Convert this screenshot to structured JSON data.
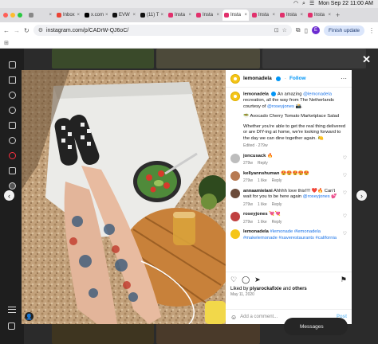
{
  "menubar": {
    "clock": "Mon Sep 22  11:00 AM"
  },
  "tabs": [
    {
      "label": "",
      "color": "#888888",
      "active": false
    },
    {
      "label": "Inbox",
      "color": "#ea4335",
      "active": false
    },
    {
      "label": "x.com",
      "color": "#000000",
      "active": false
    },
    {
      "label": "EVW",
      "color": "#111111",
      "active": false
    },
    {
      "label": "(11) T",
      "color": "#111111",
      "active": false
    },
    {
      "label": "Insta",
      "color": "#e1306c",
      "active": false
    },
    {
      "label": "Insta",
      "color": "#e1306c",
      "active": false
    },
    {
      "label": "Insta",
      "color": "#e1306c",
      "active": true
    },
    {
      "label": "Insta",
      "color": "#e1306c",
      "active": false
    },
    {
      "label": "Insta",
      "color": "#e1306c",
      "active": false
    },
    {
      "label": "Insta",
      "color": "#e1306c",
      "active": false
    }
  ],
  "toolbar": {
    "url": "instagram.com/p/CADrW-QJ6oC/",
    "profile_initial": "E",
    "finish_update": "Finish update"
  },
  "post": {
    "username": "lemonadela",
    "follow": "Follow",
    "caption_user": "lemonadela",
    "caption_text": "An amazing ",
    "caption_mention": "@lemonadela",
    "caption_text2": " recreation, all the way from The Netherlands courtesy of ",
    "caption_mention2": "@roseyjones",
    "caption_emoji": "📸.",
    "caption_line2": "🥗 Avocado Cherry Tomato Marketplace Salad",
    "caption_line3": "Whether you're able to get the real thing delivered or are DIY-ing at home, we're looking forward to the day we can dine together again.",
    "caption_line3_emoji": "🍋",
    "caption_meta": "Edited · 279w",
    "comments": [
      {
        "user": "joncusack",
        "text": "🔥",
        "time": "279w",
        "likes": "",
        "reply": "Reply",
        "avatar": "#bdbdbd"
      },
      {
        "user": "kellyannshuman",
        "text": "😍😍😍😍😍",
        "time": "279w",
        "likes": "1 like",
        "reply": "Reply",
        "avatar": "#b77a52"
      },
      {
        "user": "annaamielani",
        "text": "Ahhhh love this!!!! ❤️🔥 Can't wait for you to be here again ",
        "mention": "@roseyjones",
        "tail": " 💕",
        "time": "279w",
        "likes": "1 like",
        "reply": "Reply",
        "avatar": "#6b4b3a"
      },
      {
        "user": "roseyjones",
        "text": "💘💘",
        "time": "279w",
        "likes": "1 like",
        "reply": "Reply",
        "avatar": "#c04040"
      },
      {
        "user": "lemonadela",
        "text": "",
        "tags": "#lemonade #lemonadela #makelemonade #saverestaurants #california",
        "time": "",
        "likes": "",
        "reply": "",
        "avatar": "#f5c518"
      }
    ],
    "liked_by_prefix": "Liked by ",
    "liked_by_user": "piyarockafixie",
    "liked_by_suffix": " and ",
    "liked_by_others": "others",
    "date": "May 11, 2020",
    "add_comment": "Add a comment...",
    "post_button": "Post"
  },
  "messages_label": "Messages"
}
